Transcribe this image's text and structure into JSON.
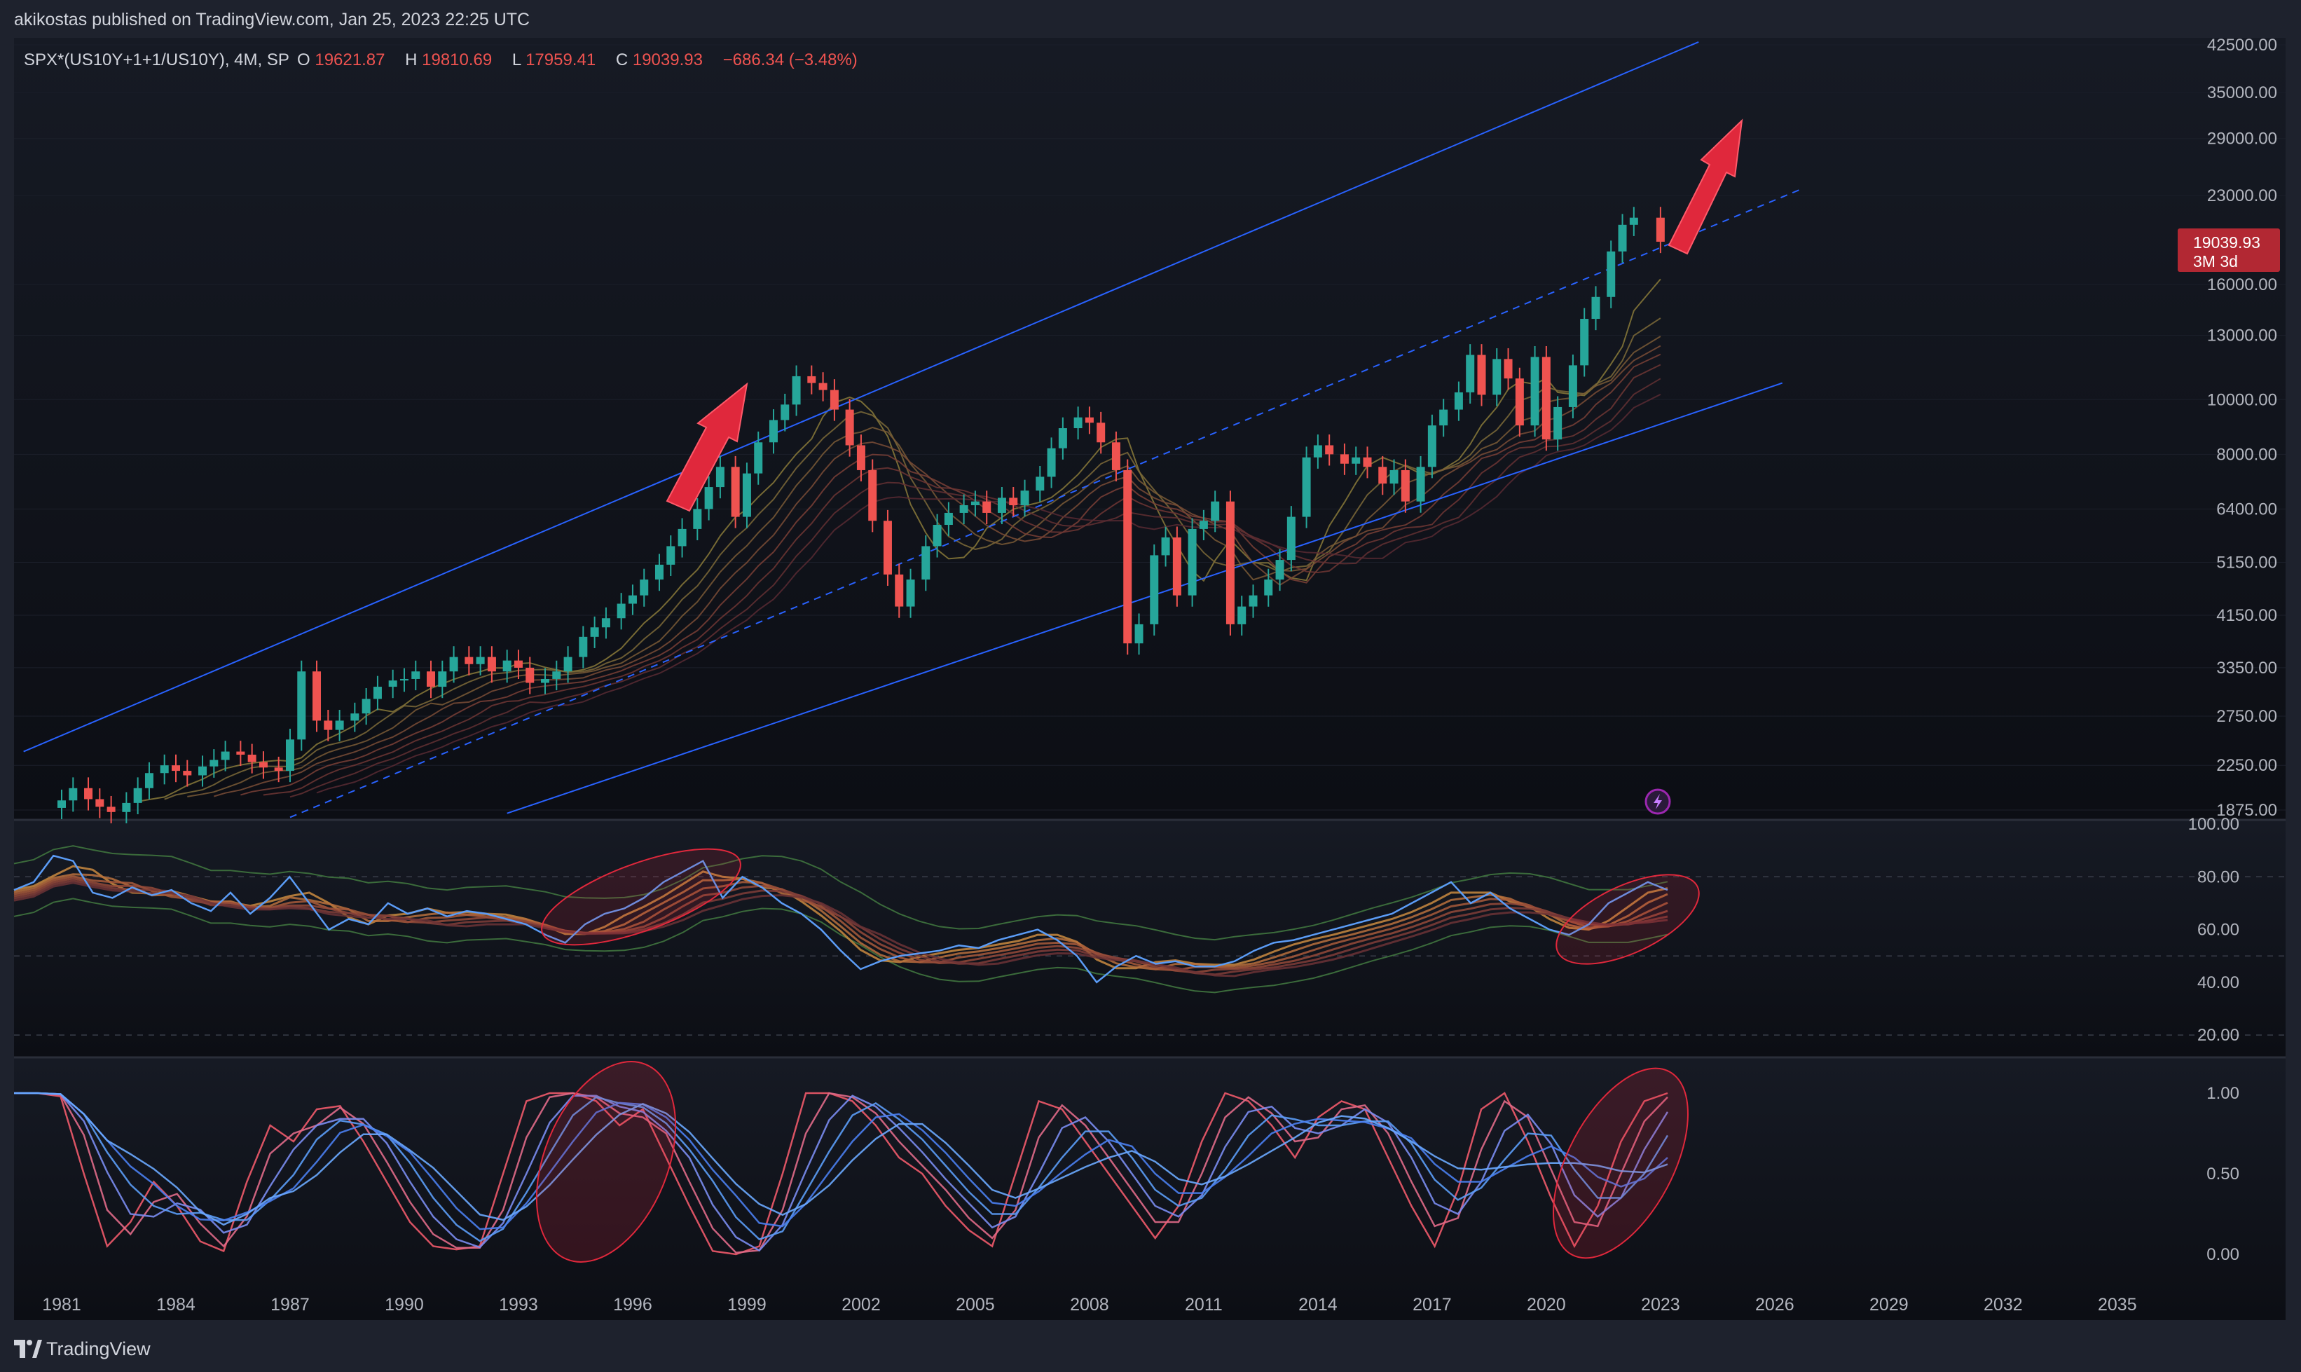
{
  "header": {
    "published": "akikostas published on TradingView.com, Jan 25, 2023 22:25 UTC"
  },
  "legend": {
    "symbol": "SPX*(US10Y+1+1/US10Y), 4M, SP",
    "o_label": "O",
    "o_value": "19621.87",
    "h_label": "H",
    "h_value": "19810.69",
    "l_label": "L",
    "l_value": "17959.41",
    "c_label": "C",
    "c_value": "19039.93",
    "change": "−686.34 (−3.48%)"
  },
  "price_tag": {
    "price": "19039.93",
    "countdown": "3M 3d"
  },
  "footer": {
    "brand": "TradingView"
  },
  "colors": {
    "background": "#131722",
    "up": "#26a69a",
    "down": "#ef5350",
    "channel": "#2962ff",
    "annotation": "#e0283c",
    "rsi": "#5b9cf6"
  },
  "chart_data": [
    {
      "type": "candlestick",
      "title": "",
      "y_scale": "log",
      "ylim": [
        1800,
        45000
      ],
      "xlim": [
        1980.0,
        2036.5
      ],
      "y_ticks": [
        "42500.00",
        "35000.00",
        "29000.00",
        "23000.00",
        "16000.00",
        "13000.00",
        "10000.00",
        "8000.00",
        "6400.00",
        "5150.00",
        "4150.00",
        "3350.00",
        "2750.00",
        "2250.00",
        "1875.00"
      ],
      "x_ticks": [
        "1981",
        "1984",
        "1987",
        "1990",
        "1993",
        "1996",
        "1999",
        "2002",
        "2005",
        "2008",
        "2011",
        "2014",
        "2017",
        "2020",
        "2023",
        "2026",
        "2029",
        "2032",
        "2035"
      ],
      "candles_close": [
        [
          1981.0,
          1950
        ],
        [
          1981.3,
          2050
        ],
        [
          1981.7,
          1960
        ],
        [
          1982.0,
          1900
        ],
        [
          1982.3,
          1860
        ],
        [
          1982.7,
          1930
        ],
        [
          1983.0,
          2050
        ],
        [
          1983.3,
          2180
        ],
        [
          1983.7,
          2250
        ],
        [
          1984.0,
          2200
        ],
        [
          1984.3,
          2160
        ],
        [
          1984.7,
          2240
        ],
        [
          1985.0,
          2300
        ],
        [
          1985.3,
          2380
        ],
        [
          1985.7,
          2350
        ],
        [
          1986.0,
          2280
        ],
        [
          1986.3,
          2230
        ],
        [
          1986.7,
          2200
        ],
        [
          1987.0,
          2500
        ],
        [
          1987.3,
          3300
        ],
        [
          1987.7,
          2700
        ],
        [
          1988.0,
          2600
        ],
        [
          1988.3,
          2700
        ],
        [
          1988.7,
          2780
        ],
        [
          1989.0,
          2950
        ],
        [
          1989.3,
          3100
        ],
        [
          1989.7,
          3180
        ],
        [
          1990.0,
          3200
        ],
        [
          1990.3,
          3300
        ],
        [
          1990.7,
          3100
        ],
        [
          1991.0,
          3300
        ],
        [
          1991.3,
          3500
        ],
        [
          1991.7,
          3400
        ],
        [
          1992.0,
          3500
        ],
        [
          1992.3,
          3300
        ],
        [
          1992.7,
          3450
        ],
        [
          1993.0,
          3350
        ],
        [
          1993.3,
          3150
        ],
        [
          1993.7,
          3200
        ],
        [
          1994.0,
          3300
        ],
        [
          1994.3,
          3500
        ],
        [
          1994.7,
          3800
        ],
        [
          1995.0,
          3950
        ],
        [
          1995.3,
          4100
        ],
        [
          1995.7,
          4350
        ],
        [
          1996.0,
          4500
        ],
        [
          1996.3,
          4800
        ],
        [
          1996.7,
          5100
        ],
        [
          1997.0,
          5500
        ],
        [
          1997.3,
          5900
        ],
        [
          1997.7,
          6400
        ],
        [
          1998.0,
          7000
        ],
        [
          1998.3,
          7600
        ],
        [
          1998.7,
          6200
        ],
        [
          1999.0,
          7400
        ],
        [
          1999.3,
          8400
        ],
        [
          1999.7,
          9200
        ],
        [
          2000.0,
          9800
        ],
        [
          2000.3,
          11000
        ],
        [
          2000.7,
          10700
        ],
        [
          2001.0,
          10400
        ],
        [
          2001.3,
          9600
        ],
        [
          2001.7,
          8300
        ],
        [
          2002.0,
          7500
        ],
        [
          2002.3,
          6100
        ],
        [
          2002.7,
          4900
        ],
        [
          2003.0,
          4300
        ],
        [
          2003.3,
          4800
        ],
        [
          2003.7,
          5500
        ],
        [
          2004.0,
          6000
        ],
        [
          2004.3,
          6300
        ],
        [
          2004.7,
          6500
        ],
        [
          2005.0,
          6600
        ],
        [
          2005.3,
          6300
        ],
        [
          2005.7,
          6700
        ],
        [
          2006.0,
          6500
        ],
        [
          2006.3,
          6900
        ],
        [
          2006.7,
          7300
        ],
        [
          2007.0,
          8200
        ],
        [
          2007.3,
          8900
        ],
        [
          2007.7,
          9300
        ],
        [
          2008.0,
          9100
        ],
        [
          2008.3,
          8400
        ],
        [
          2008.7,
          7500
        ],
        [
          2009.0,
          3700
        ],
        [
          2009.3,
          4000
        ],
        [
          2009.7,
          5300
        ],
        [
          2010.0,
          5700
        ],
        [
          2010.3,
          4500
        ],
        [
          2010.7,
          5900
        ],
        [
          2011.0,
          6100
        ],
        [
          2011.3,
          6600
        ],
        [
          2011.7,
          4000
        ],
        [
          2012.0,
          4300
        ],
        [
          2012.3,
          4500
        ],
        [
          2012.7,
          4800
        ],
        [
          2013.0,
          5200
        ],
        [
          2013.3,
          6200
        ],
        [
          2013.7,
          7900
        ],
        [
          2014.0,
          8300
        ],
        [
          2014.3,
          8000
        ],
        [
          2014.7,
          7700
        ],
        [
          2015.0,
          7900
        ],
        [
          2015.3,
          7600
        ],
        [
          2015.7,
          7100
        ],
        [
          2016.0,
          7500
        ],
        [
          2016.3,
          6600
        ],
        [
          2016.7,
          7600
        ],
        [
          2017.0,
          9000
        ],
        [
          2017.3,
          9600
        ],
        [
          2017.7,
          10300
        ],
        [
          2018.0,
          12000
        ],
        [
          2018.3,
          10200
        ],
        [
          2018.7,
          11800
        ],
        [
          2019.0,
          10900
        ],
        [
          2019.3,
          9000
        ],
        [
          2019.7,
          11900
        ],
        [
          2020.0,
          8500
        ],
        [
          2020.3,
          9700
        ],
        [
          2020.7,
          11500
        ],
        [
          2021.0,
          13900
        ],
        [
          2021.3,
          15200
        ],
        [
          2021.7,
          18300
        ],
        [
          2022.0,
          20400
        ],
        [
          2022.3,
          21000
        ],
        [
          2023.0,
          19039.93
        ]
      ],
      "channel": {
        "upper_start": [
          1980.0,
          2380
        ],
        "upper_end": [
          2024.0,
          43000
        ],
        "lower_start": [
          1992.7,
          1850
        ],
        "lower_end": [
          2026.2,
          10700
        ],
        "mid_start": [
          1987.0,
          1820
        ],
        "mid_end": [
          2026.7,
          23600
        ]
      }
    },
    {
      "type": "line",
      "title": "",
      "ylim": [
        15,
        100
      ],
      "y_ticks": [
        "100.00",
        "80.00",
        "60.00",
        "40.00",
        "20.00"
      ],
      "series": [
        {
          "values": [
            75,
            78,
            88,
            86,
            74,
            72,
            76,
            73,
            75,
            70,
            67,
            74,
            66,
            72,
            80,
            70,
            60,
            64,
            62,
            70,
            66,
            68,
            65,
            67,
            66,
            64,
            62,
            58,
            55,
            62,
            66,
            68,
            72,
            78,
            82,
            86,
            72,
            80,
            76,
            70,
            66,
            60,
            52,
            45,
            48,
            50,
            51,
            52,
            54,
            53,
            56,
            58,
            60,
            56,
            50,
            40,
            46,
            50,
            47,
            48,
            46,
            46,
            48,
            52,
            55,
            56,
            58,
            60,
            62,
            64,
            66,
            70,
            74,
            78,
            70,
            74,
            68,
            64,
            60,
            58,
            62,
            70,
            74,
            78,
            75
          ]
        }
      ]
    },
    {
      "type": "line",
      "title": "",
      "ylim": [
        -0.1,
        1.1
      ],
      "y_ticks": [
        "1.00",
        "0.50",
        "0.00"
      ],
      "series": [
        {
          "values": [
            1.0,
            1.0,
            0.98,
            0.5,
            0.05,
            0.2,
            0.45,
            0.3,
            0.08,
            0.02,
            0.45,
            0.8,
            0.7,
            0.9,
            0.92,
            0.7,
            0.45,
            0.2,
            0.05,
            0.03,
            0.05,
            0.5,
            0.95,
            1.0,
            1.0,
            0.95,
            0.8,
            0.9,
            0.6,
            0.3,
            0.02,
            0.0,
            0.05,
            0.5,
            1.0,
            1.0,
            0.95,
            0.8,
            0.6,
            0.5,
            0.3,
            0.15,
            0.05,
            0.5,
            0.95,
            0.9,
            0.7,
            0.5,
            0.3,
            0.1,
            0.3,
            0.7,
            1.0,
            0.95,
            0.8,
            0.6,
            0.85,
            0.95,
            0.9,
            0.6,
            0.3,
            0.05,
            0.4,
            0.9,
            1.0,
            0.7,
            0.35,
            0.05,
            0.3,
            0.7,
            0.95,
            1.0
          ]
        }
      ]
    }
  ]
}
